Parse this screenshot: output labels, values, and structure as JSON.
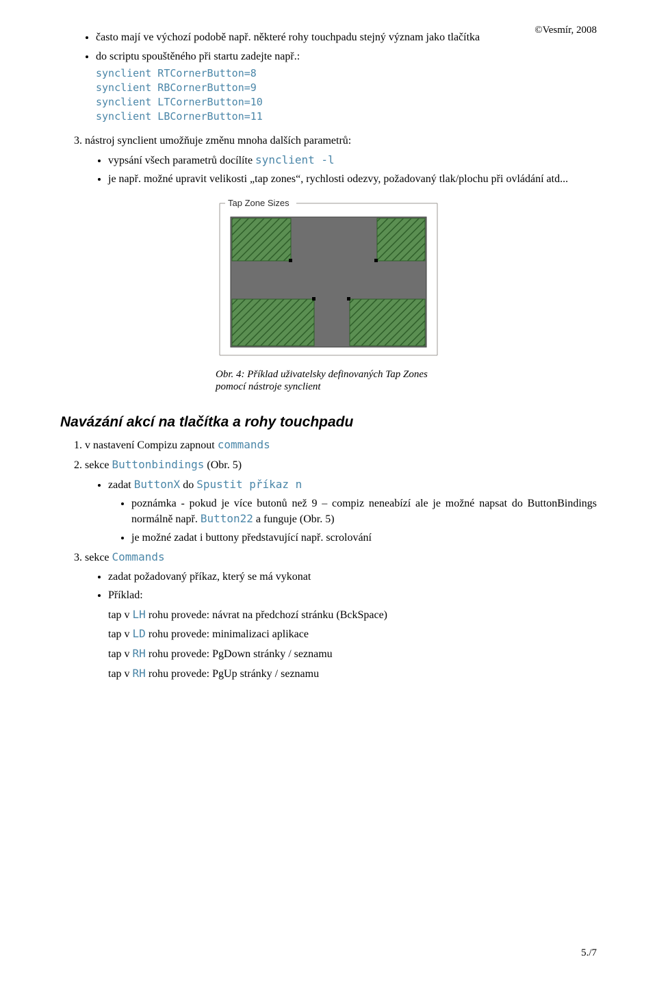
{
  "copyright": "©Vesmír, 2008",
  "top_list": {
    "item1": "často mají ve výchozí podobě např. některé rohy touchpadu stejný význam jako tlačítka",
    "item2": "do scriptu spouštěného při startu zadejte např.:",
    "code_l1": "synclient RTCornerButton=8",
    "code_l2": "synclient RBCornerButton=9",
    "code_l3": "synclient LTCornerButton=10",
    "code_l4": "synclient LBCornerButton=11"
  },
  "ol3": {
    "lead": "nástroj synclient umožňuje změnu mnoha dalších parametrů:",
    "b1_pre": "vypsání všech parametrů docílíte ",
    "b1_code": "synclient -l",
    "b2": "je např. možné upravit velikosti „tap zones“, rychlosti odezvy, požadovaný tlak/plochu při ovládání atd..."
  },
  "figure": {
    "legend": "Tap Zone Sizes",
    "caption": "Obr. 4: Příklad uživatelsky definovaných Tap Zones pomocí nástroje synclient"
  },
  "section_heading": "Navázání akcí na tlačítka a rohy touchpadu",
  "sec_ol": {
    "i1_pre": "v nastavení Compizu zapnout ",
    "i1_code": "commands",
    "i2_pre": "sekce ",
    "i2_code": "Buttonbindings",
    "i2_suf": "  (Obr. 5)",
    "i2_b1_pre": "zadat ",
    "i2_b1_code1": "ButtonX",
    "i2_b1_mid": " do ",
    "i2_b1_code2": "Spustit příkaz n",
    "i2_b1_s1_pre": "poznámka - pokud je více butonů než 9 – compiz neneabízí ale je možné napsat do ButtonBindings normálně např. ",
    "i2_b1_s1_code": "Button22",
    "i2_b1_s1_suf": " a funguje (Obr. 5)",
    "i2_b1_s2": "je možné zadat i buttony představující např. scrolování",
    "i3_pre": "sekce ",
    "i3_code": "Commands",
    "i3_b1": "zadat požadovaný příkaz, který se má vykonat",
    "i3_b2": "Příklad:",
    "ex1_pre": "tap v ",
    "ex1_code": "LH",
    "ex1_suf": " rohu provede: návrat na předchozí stránku (BckSpace)",
    "ex2_pre": "tap v ",
    "ex2_code": "LD",
    "ex2_suf": " rohu provede: minimalizaci aplikace",
    "ex3_pre": "tap v ",
    "ex3_code": "RH",
    "ex3_suf": " rohu provede: PgDown stránky / seznamu",
    "ex4_pre": "tap v ",
    "ex4_code": "RH",
    "ex4_suf": " rohu provede: PgUp stránky / seznamu"
  },
  "footer": "5./7"
}
